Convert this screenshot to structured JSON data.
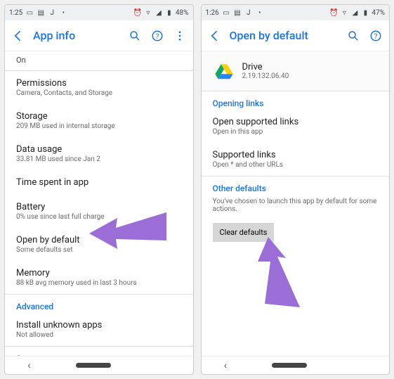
{
  "left": {
    "status": {
      "time": "1:25",
      "battery": "48%"
    },
    "appbar": {
      "title": "App info"
    },
    "on": "On",
    "rows": {
      "permissions": {
        "label": "Permissions",
        "sub": "Camera, Contacts, and Storage"
      },
      "storage": {
        "label": "Storage",
        "sub": "209 MB used in internal storage"
      },
      "data": {
        "label": "Data usage",
        "sub": "33.81 MB used since Jan 2"
      },
      "time": {
        "label": "Time spent in app",
        "sub": ""
      },
      "battery": {
        "label": "Battery",
        "sub": "0% use since last full charge"
      },
      "open": {
        "label": "Open by default",
        "sub": "Some defaults set"
      },
      "memory": {
        "label": "Memory",
        "sub": "88 kB avg memory used in last 3 hours"
      },
      "install": {
        "label": "Install unknown apps",
        "sub": "Not allowed"
      }
    },
    "advanced": "Advanced",
    "store": "Store"
  },
  "right": {
    "status": {
      "time": "1:26",
      "battery": "47%"
    },
    "appbar": {
      "title": "Open by default"
    },
    "app": {
      "name": "Drive",
      "version": "2.19.132.06.40"
    },
    "sec_links": "Opening links",
    "rows": {
      "supported": {
        "label": "Open supported links",
        "sub": "Open in this app"
      },
      "links": {
        "label": "Supported links",
        "sub": "Open * and other URLs"
      }
    },
    "sec_other": "Other defaults",
    "helper": "You've chosen to launch this app by default for some actions.",
    "btn_clear": "Clear defaults"
  }
}
